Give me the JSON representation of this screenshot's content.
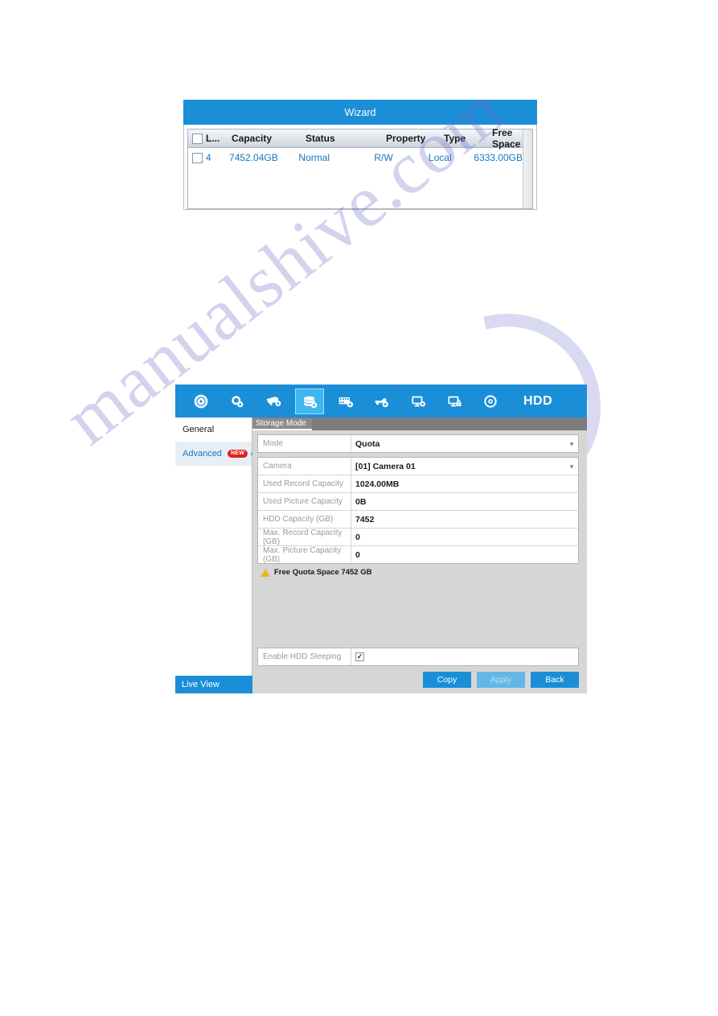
{
  "watermark": {
    "text": "manualshive.com"
  },
  "wizard": {
    "title": "Wizard",
    "table": {
      "columns": [
        "L...",
        "Capacity",
        "Status",
        "Property",
        "Type",
        "Free Space"
      ],
      "rows": [
        {
          "label": "4",
          "capacity": "7452.04GB",
          "status": "Normal",
          "property": "R/W",
          "type": "Local",
          "free_space": "6333.00GB"
        }
      ]
    }
  },
  "nvr": {
    "toolbar": {
      "title": "HDD",
      "icons": [
        {
          "name": "playback-settings-icon",
          "selected": false
        },
        {
          "name": "search-settings-icon",
          "selected": false
        },
        {
          "name": "camera-settings-icon",
          "selected": false
        },
        {
          "name": "hdd-settings-icon",
          "selected": true
        },
        {
          "name": "record-settings-icon",
          "selected": false
        },
        {
          "name": "alarm-settings-icon",
          "selected": false
        },
        {
          "name": "network-settings-icon",
          "selected": false
        },
        {
          "name": "system-security-icon",
          "selected": false
        },
        {
          "name": "system-info-icon",
          "selected": false
        }
      ]
    },
    "sidebar": {
      "items": [
        {
          "label": "General",
          "active": false,
          "badge": "",
          "chevron": ""
        },
        {
          "label": "Advanced",
          "active": true,
          "badge": "NEW",
          "chevron": "›"
        }
      ],
      "live_view_label": "Live View"
    },
    "tabs": [
      {
        "label": "Storage Mode",
        "active": true
      }
    ],
    "form": {
      "mode": {
        "label": "Mode",
        "value": "Quota",
        "type": "select"
      },
      "rows": [
        {
          "label": "Camera",
          "value": "[01] Camera 01",
          "type": "select"
        },
        {
          "label": "Used Record Capacity",
          "value": "1024.00MB",
          "type": "text"
        },
        {
          "label": "Used Picture Capacity",
          "value": "0B",
          "type": "text"
        },
        {
          "label": "HDD Capacity (GB)",
          "value": "7452",
          "type": "text"
        },
        {
          "label": "Max. Record Capacity (GB)",
          "value": "0",
          "type": "input"
        },
        {
          "label": "Max. Picture Capacity (GB)",
          "value": "0",
          "type": "input"
        }
      ],
      "quota_note": "Free Quota Space 7452 GB",
      "hdd_sleeping": {
        "label": "Enable HDD Sleeping",
        "checked": true,
        "check_glyph": "✓"
      }
    },
    "buttons": [
      {
        "label": "Copy",
        "disabled": false
      },
      {
        "label": "Apply",
        "disabled": true
      },
      {
        "label": "Back",
        "disabled": false
      }
    ]
  },
  "colors": {
    "brand_blue": "#1a8fd8",
    "selected_icon_bg": "#3fb6ef",
    "link_blue": "#1478be",
    "badge_red": "#e02020",
    "warning_yellow": "#f0b323",
    "panel_gray": "#d6d6d6",
    "tabbar_gray": "#7d7d7d"
  }
}
